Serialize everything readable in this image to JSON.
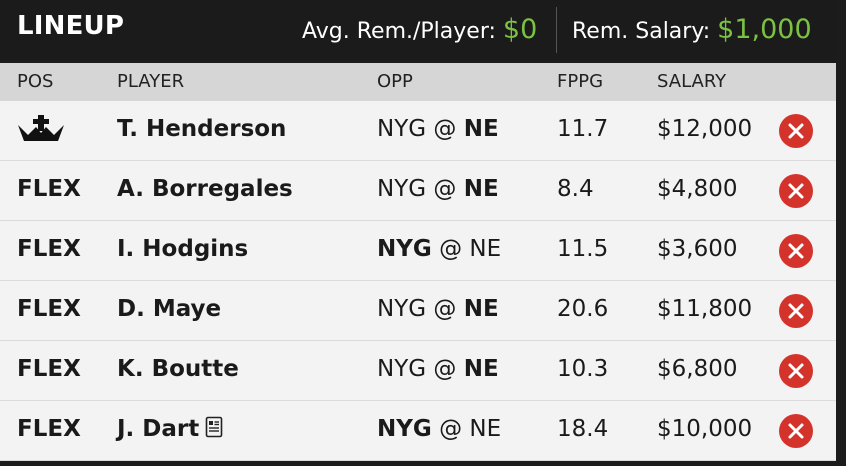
{
  "header": {
    "title": "LINEUP",
    "avg_label": "Avg. Rem./Player:",
    "avg_value": "$0",
    "rem_label": "Rem. Salary:",
    "rem_value": "$1,000",
    "accent_color": "#7cc242"
  },
  "columns": {
    "pos": "POS",
    "player": "PLAYER",
    "opp": "OPP",
    "fppg": "FPPG",
    "salary": "SALARY"
  },
  "rows": [
    {
      "pos": "",
      "pos_icon": "captain-crown-icon",
      "player": "T. Henderson",
      "away": "NYG",
      "at": "@",
      "home": "NE",
      "bold_team": "home",
      "fppg": "11.7",
      "salary": "$12,000"
    },
    {
      "pos": "FLEX",
      "player": "A. Borregales",
      "away": "NYG",
      "at": "@",
      "home": "NE",
      "bold_team": "home",
      "fppg": "8.4",
      "salary": "$4,800"
    },
    {
      "pos": "FLEX",
      "player": "I. Hodgins",
      "away": "NYG",
      "at": "@",
      "home": "NE",
      "bold_team": "away",
      "fppg": "11.5",
      "salary": "$3,600"
    },
    {
      "pos": "FLEX",
      "player": "D. Maye",
      "away": "NYG",
      "at": "@",
      "home": "NE",
      "bold_team": "home",
      "fppg": "20.6",
      "salary": "$11,800"
    },
    {
      "pos": "FLEX",
      "player": "K. Boutte",
      "away": "NYG",
      "at": "@",
      "home": "NE",
      "bold_team": "home",
      "fppg": "10.3",
      "salary": "$6,800"
    },
    {
      "pos": "FLEX",
      "player": "J. Dart",
      "player_icon": "news-icon",
      "away": "NYG",
      "at": "@",
      "home": "NE",
      "bold_team": "away",
      "fppg": "18.4",
      "salary": "$10,000"
    }
  ],
  "remove_icon": "remove-x-icon",
  "remove_color": "#d4332c"
}
